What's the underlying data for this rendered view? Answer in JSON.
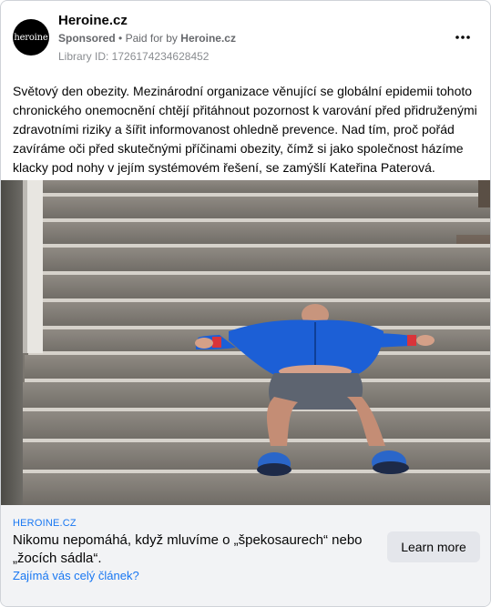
{
  "header": {
    "avatar_text": "heroine",
    "page_name": "Heroine.cz",
    "sponsored_label": "Sponsored",
    "paid_for_prefix": "Paid for by",
    "paid_for_name": "Heroine.cz",
    "library_id": "Library ID: 1726174234628452",
    "more_icon": "more-horizontal-icon"
  },
  "post": {
    "text": "Světový den obezity. Mezinárodní organizace věnující se globální epidemii tohoto chronického onemocnění chtějí přitáhnout pozornost k varování před přidruženými zdravotními riziky a šířit informovanost ohledně prevence. Nad tím, proč pořád zavíráme oči před skutečnými příčinami obezity, čímž si jako společnost házíme klacky pod nohy v jejím systémovém řešení, se zamýšlí Kateřina Paterová."
  },
  "link": {
    "domain": "HEROINE.CZ",
    "headline": "Nikomu nepomáhá, když mluvíme o „špekosaurech“ nebo „žocích sádla“.",
    "description": "Zajímá vás celý článek?",
    "cta_label": "Learn more"
  },
  "colors": {
    "accent_link": "#1877f2",
    "secondary_text": "#65676b",
    "cta_background": "#e4e6eb",
    "jacket_blue": "#1c5fd6"
  }
}
